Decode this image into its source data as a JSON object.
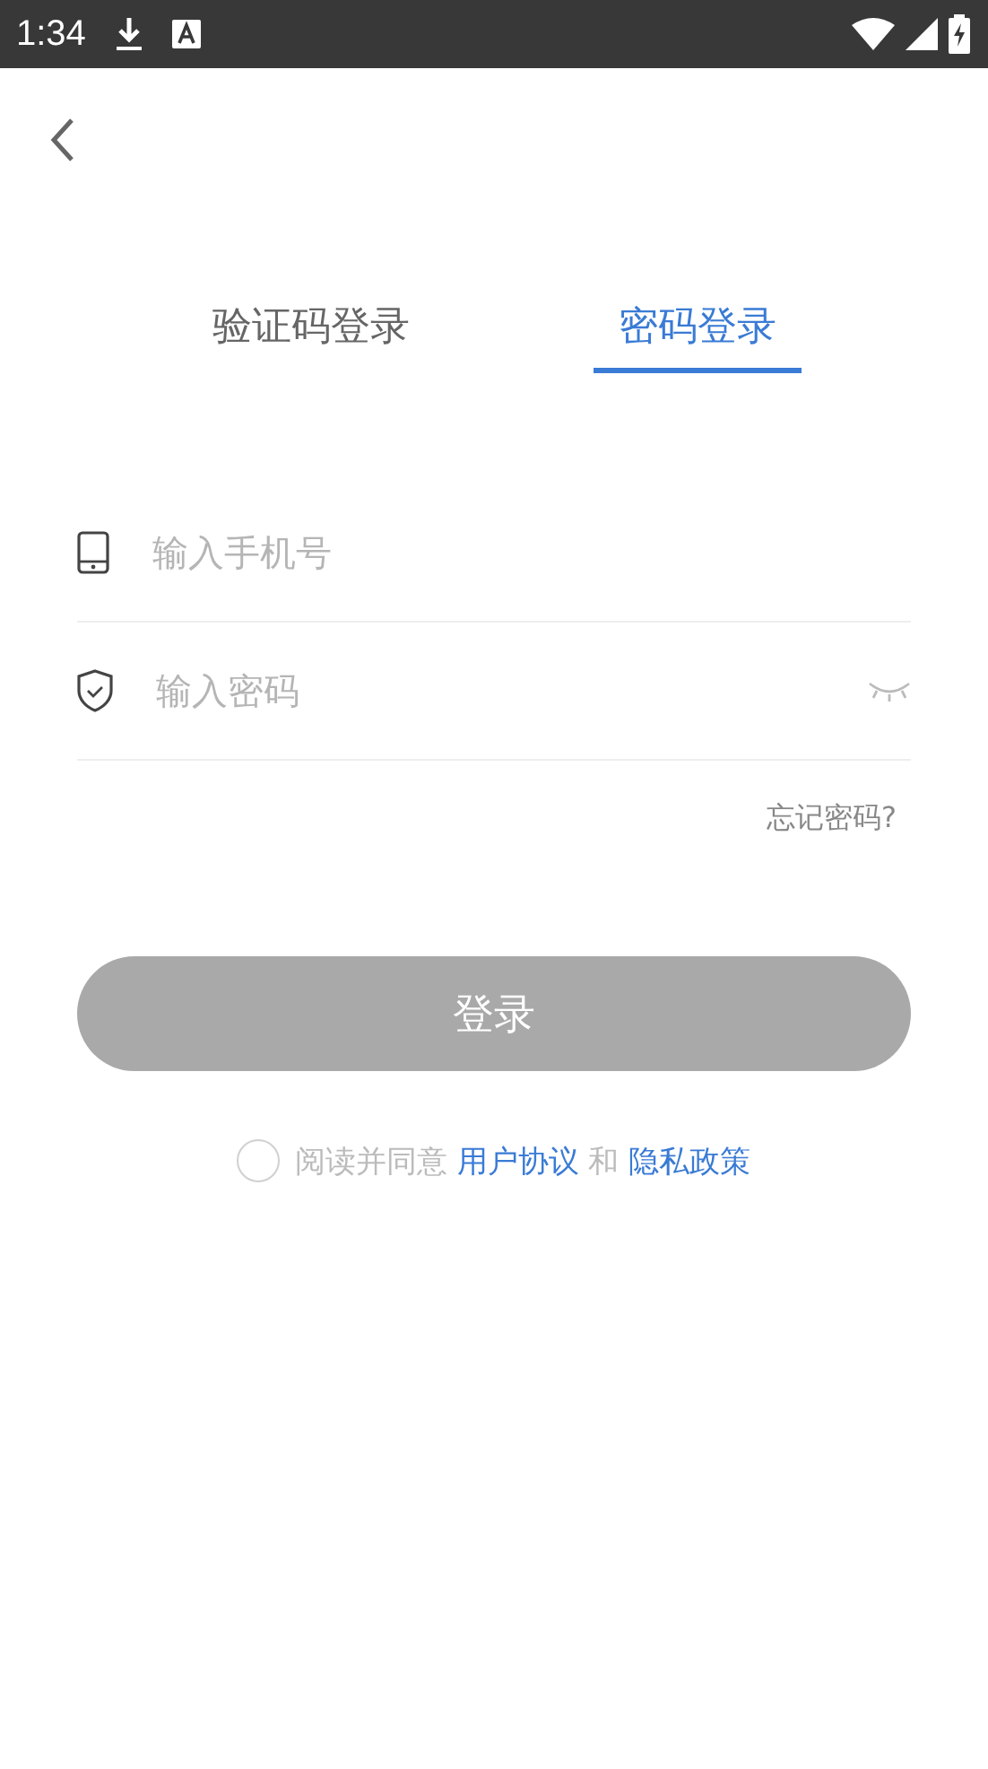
{
  "status_bar": {
    "time": "1:34"
  },
  "tabs": [
    {
      "label": "验证码登录",
      "selected": false
    },
    {
      "label": "密码登录",
      "selected": true
    }
  ],
  "phone_field": {
    "placeholder": "输入手机号"
  },
  "password_field": {
    "placeholder": "输入密码",
    "visible": false
  },
  "forgot_password": "忘记密码?",
  "login_button": {
    "label": "登录",
    "disabled": true
  },
  "agreement": {
    "checked": false,
    "parts": [
      {
        "kind": "text",
        "text": "阅读并同意"
      },
      {
        "kind": "link",
        "text": "用户协议"
      },
      {
        "kind": "text",
        "text": "和"
      },
      {
        "kind": "link",
        "text": "隐私政策"
      }
    ]
  }
}
